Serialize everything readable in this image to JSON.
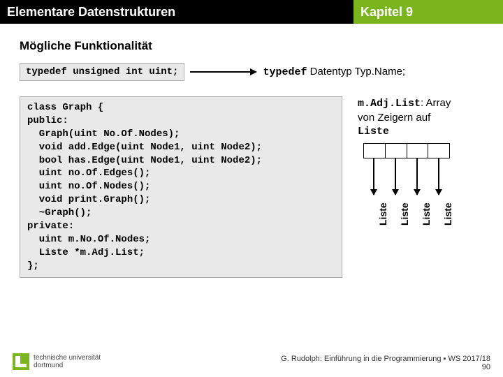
{
  "header": {
    "left": "Elementare Datenstrukturen",
    "right": "Kapitel 9"
  },
  "subtitle": "Mögliche Funktionalität",
  "typedef_code": "typedef unsigned int uint;",
  "typedef_explain_mono": "typedef",
  "typedef_explain_rest": " Datentyp Typ.Name;",
  "class_code": "class Graph {\npublic:\n  Graph(uint No.Of.Nodes);\n  void add.Edge(uint Node1, uint Node2);\n  bool has.Edge(uint Node1, uint Node2);\n  uint no.Of.Edges();\n  uint no.Of.Nodes();\n  void print.Graph();\n  ~Graph();\nprivate:\n  uint m.No.Of.Nodes;\n  Liste *m.Adj.List;\n};",
  "adjlist": {
    "label_mono1": "m.Adj.List",
    "text1": ": Array",
    "text2": "von Zeigern auf",
    "label_mono2": "Liste",
    "list_word": "Liste"
  },
  "footer": {
    "line1": "G. Rudolph: Einführung in die Programmierung ▪ WS 2017/18",
    "line2": "90"
  },
  "logo": {
    "line1": "technische universität",
    "line2": "dortmund"
  }
}
